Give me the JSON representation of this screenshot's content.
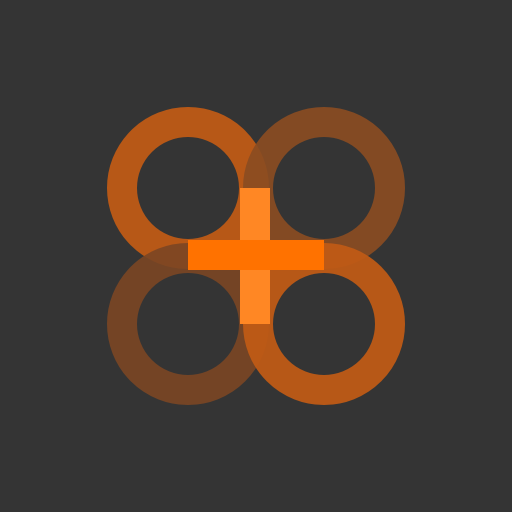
{
  "logo": {
    "icon": "four-loop-cross-logo",
    "colors": {
      "background": "#343434",
      "primary": "#ff7200",
      "loop_strong": "#c85a12",
      "loop_soft": "#8a4c22",
      "loop_softer": "#6f4426"
    }
  }
}
